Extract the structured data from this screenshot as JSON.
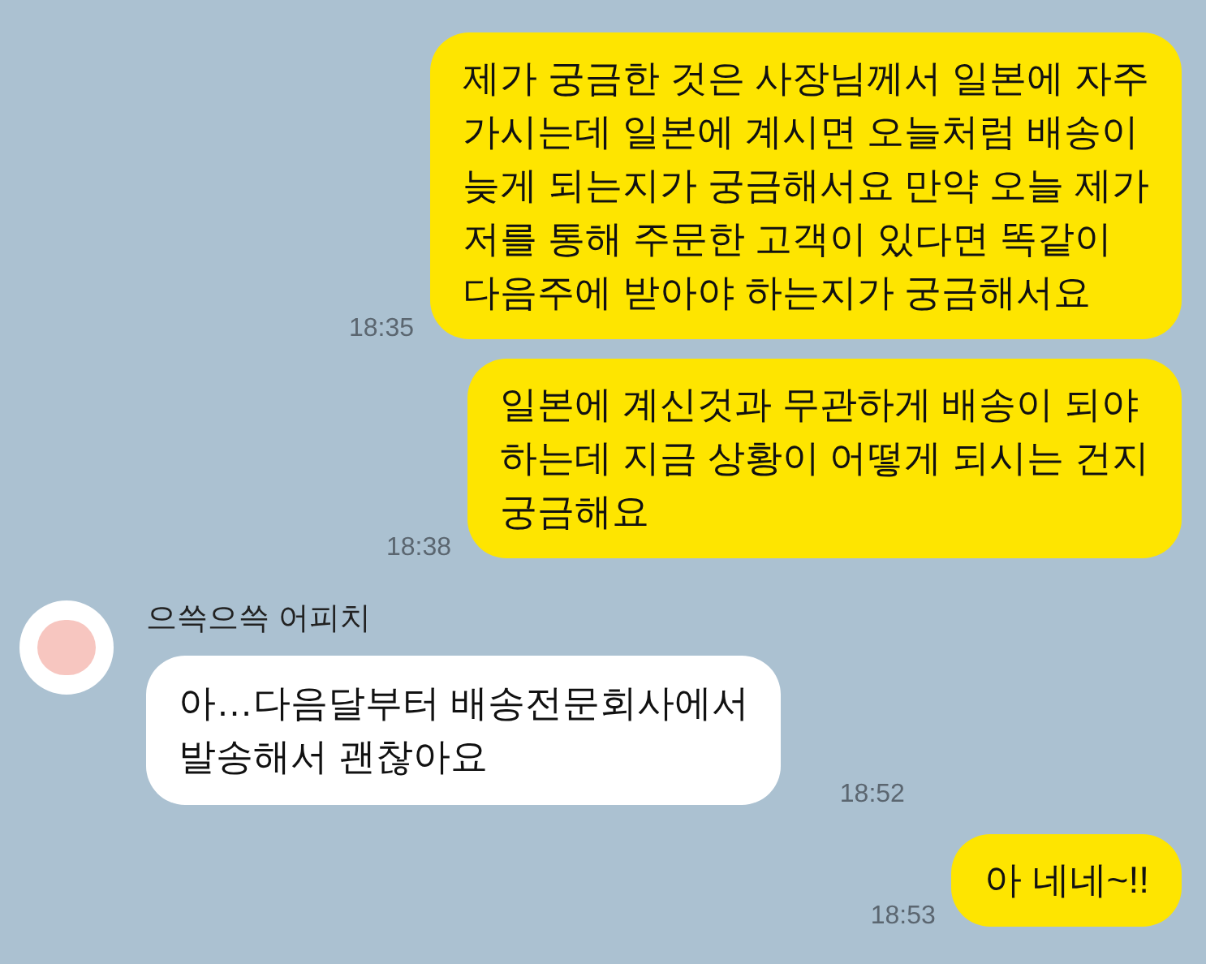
{
  "messages": [
    {
      "kind": "sent",
      "text": "제가 궁금한 것은 사장님께서  일본에 자주\n가시는데 일본에 계시면 오늘처럼 배송이\n늦게 되는지가 궁금해서요 만약 오늘 제가\n저를 통해 주문한 고객이 있다면 똑같이\n다음주에 받아야 하는지가 궁금해서요",
      "time": "18:35"
    },
    {
      "kind": "sent",
      "text": "일본에 계신것과 무관하게 배송이 되야\n하는데 지금 상황이 어떻게 되시는 건지\n궁금해요",
      "time": "18:38"
    },
    {
      "kind": "received",
      "sender": "으쓱으쓱 어피치",
      "text": "아…다음달부터 배송전문회사에서\n발송해서 괜찮아요",
      "time": "18:52"
    },
    {
      "kind": "sent",
      "text": "아 네네~!!",
      "time": "18:53"
    }
  ]
}
